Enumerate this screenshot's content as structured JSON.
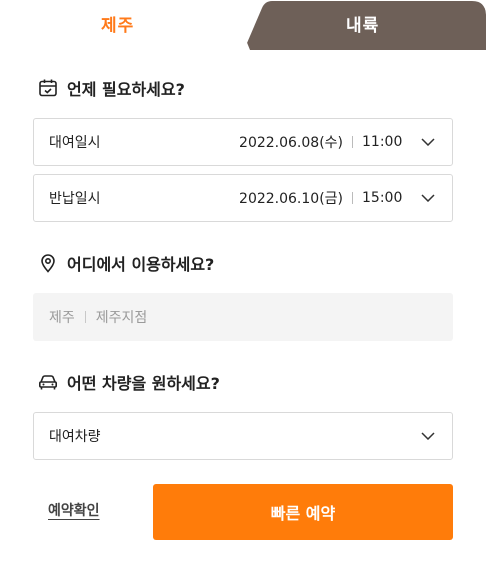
{
  "tabs": [
    {
      "label": "제주",
      "active": true
    },
    {
      "label": "내륙",
      "active": false
    }
  ],
  "sections": {
    "when": {
      "title": "언제 필요하세요?",
      "icon": "calendar-icon"
    },
    "where": {
      "title": "어디에서 이용하세요?",
      "icon": "location-pin-icon"
    },
    "vehicle": {
      "title": "어떤 차량을 원하세요?",
      "icon": "car-icon"
    }
  },
  "rental": {
    "label": "대여일시",
    "date": "2022.06.08(수)",
    "time": "11:00"
  },
  "return": {
    "label": "반납일시",
    "date": "2022.06.10(금)",
    "time": "15:00"
  },
  "location": {
    "region": "제주",
    "branch": "제주지점"
  },
  "vehicle_select": {
    "value": "대여차량"
  },
  "actions": {
    "confirm_label": "예약확인",
    "quick_label": "빠른 예약"
  },
  "colors": {
    "accent": "#ff7c0a",
    "inactive_tab": "#6e6058",
    "field_bg": "#f4f4f4"
  }
}
